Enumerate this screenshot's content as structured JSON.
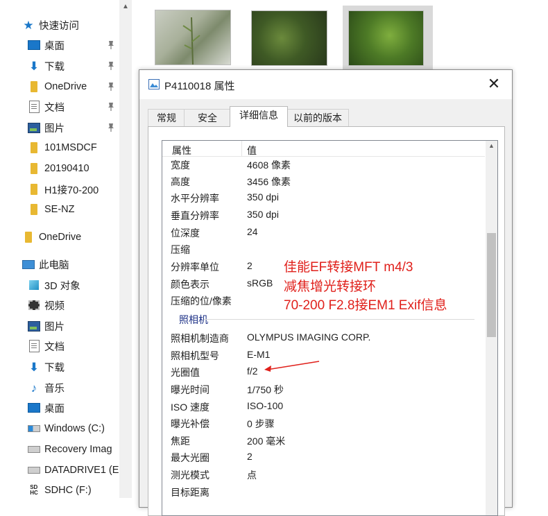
{
  "nav": {
    "items": [
      {
        "label": "快速访问",
        "icon": "star-icon",
        "pinned": false
      },
      {
        "label": "桌面",
        "icon": "desktop-icon",
        "pinned": true
      },
      {
        "label": "下载",
        "icon": "download-icon",
        "pinned": true
      },
      {
        "label": "OneDrive",
        "icon": "folder-icon",
        "pinned": true
      },
      {
        "label": "文档",
        "icon": "document-icon",
        "pinned": true
      },
      {
        "label": "图片",
        "icon": "pictures-icon",
        "pinned": true
      },
      {
        "label": "101MSDCF",
        "icon": "folder-icon",
        "pinned": false
      },
      {
        "label": "20190410",
        "icon": "folder-icon",
        "pinned": false
      },
      {
        "label": "H1接70-200",
        "icon": "folder-icon",
        "pinned": false
      },
      {
        "label": "SE-NZ",
        "icon": "folder-icon",
        "pinned": false
      },
      {
        "label": "OneDrive",
        "icon": "onedrive-folder-icon",
        "pinned": false
      },
      {
        "label": "此电脑",
        "icon": "computer-icon",
        "pinned": false
      },
      {
        "label": "3D 对象",
        "icon": "cube-icon",
        "pinned": false
      },
      {
        "label": "视频",
        "icon": "video-icon",
        "pinned": false
      },
      {
        "label": "图片",
        "icon": "pictures-icon",
        "pinned": false
      },
      {
        "label": "文档",
        "icon": "document-icon",
        "pinned": false
      },
      {
        "label": "下载",
        "icon": "download-icon",
        "pinned": false
      },
      {
        "label": "音乐",
        "icon": "music-icon",
        "pinned": false
      },
      {
        "label": "桌面",
        "icon": "desktop-icon",
        "pinned": false
      },
      {
        "label": "Windows (C:)",
        "icon": "windows-drive-icon",
        "pinned": false
      },
      {
        "label": "Recovery Imag",
        "icon": "drive-icon",
        "pinned": false
      },
      {
        "label": "DATADRIVE1 (E",
        "icon": "drive-icon",
        "pinned": false
      },
      {
        "label": "SDHC (F:)",
        "icon": "sd-card-icon",
        "pinned": false
      }
    ]
  },
  "dialog": {
    "title": "P4110018 属性",
    "tabs": [
      "常规",
      "安全",
      "详细信息",
      "以前的版本"
    ],
    "active_tab": 2,
    "columns": {
      "property": "属性",
      "value": "值"
    },
    "rows_image": [
      {
        "k": "宽度",
        "v": "4608 像素"
      },
      {
        "k": "高度",
        "v": "3456 像素"
      },
      {
        "k": "水平分辨率",
        "v": "350 dpi"
      },
      {
        "k": "垂直分辨率",
        "v": "350 dpi"
      },
      {
        "k": "位深度",
        "v": "24"
      },
      {
        "k": "压缩",
        "v": ""
      },
      {
        "k": "分辨率单位",
        "v": "2"
      },
      {
        "k": "颜色表示",
        "v": "sRGB"
      },
      {
        "k": "压缩的位/像素",
        "v": ""
      }
    ],
    "camera_group": "照相机",
    "rows_camera": [
      {
        "k": "照相机制造商",
        "v": "OLYMPUS IMAGING CORP."
      },
      {
        "k": "照相机型号",
        "v": "E-M1"
      },
      {
        "k": "光圈值",
        "v": "f/2"
      },
      {
        "k": "曝光时间",
        "v": "1/750 秒"
      },
      {
        "k": "ISO 速度",
        "v": "ISO-100"
      },
      {
        "k": "曝光补偿",
        "v": "0 步骤"
      },
      {
        "k": "焦距",
        "v": "200 毫米"
      },
      {
        "k": "最大光圈",
        "v": "2"
      },
      {
        "k": "测光模式",
        "v": "点"
      },
      {
        "k": "目标距离",
        "v": ""
      }
    ]
  },
  "annotation": {
    "lines": [
      "佳能EF转接MFT m4/3",
      "减焦增光转接环",
      "70-200 F2.8接EM1 Exif信息"
    ],
    "color": "#e0201b"
  }
}
